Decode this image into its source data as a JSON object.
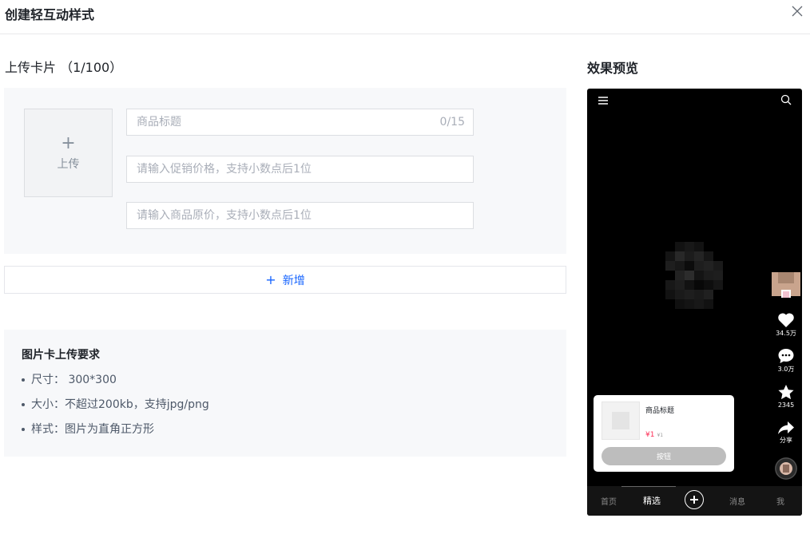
{
  "dialog": {
    "title": "创建轻互动样式"
  },
  "upload_section": {
    "title": "上传卡片  （1/100）",
    "uploader_label": "上传",
    "fields": {
      "title_placeholder": "商品标题",
      "title_count": "0/15",
      "promo_price_placeholder": "请输入促销价格，支持小数点后1位",
      "original_price_placeholder": "请输入商品原价，支持小数点后1位"
    },
    "add_label": "新增"
  },
  "requirements": {
    "title": "图片卡上传要求",
    "items": [
      "尺寸：  300*300",
      "大小：不超过200kb，支持jpg/png",
      "样式：图片为直角正方形"
    ]
  },
  "preview": {
    "title": "效果预览",
    "side": {
      "likes": "34.5万",
      "comments": "3.0万",
      "favorites": "2345",
      "share_label": "分享"
    },
    "card": {
      "title": "商品标题",
      "price": "¥1",
      "original_price": "¥1",
      "button_label": "按钮"
    },
    "tabs": [
      "首页",
      "精选",
      "消息",
      "我"
    ],
    "active_tab": "精选"
  },
  "colors": {
    "accent": "#1664ff",
    "price": "#fe2c55",
    "panel_bg": "#f7f8fa",
    "phone_bg": "#000000"
  }
}
